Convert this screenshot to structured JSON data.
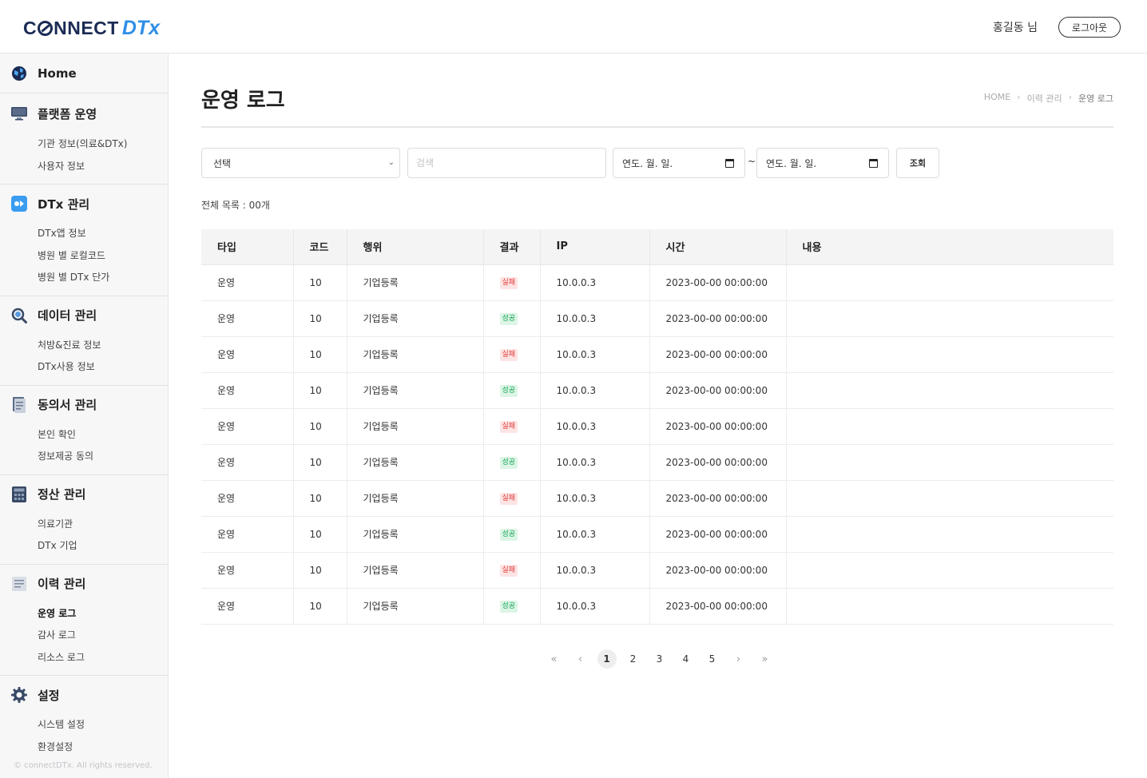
{
  "header": {
    "logo_prefix": "C",
    "logo_suffix": "NNECT",
    "logo_dtx": "DTx",
    "user_name": "홍길동 님",
    "logout_label": "로그아웃"
  },
  "sidebar": {
    "home_label": "Home",
    "sections": [
      {
        "label": "플랫폼 운영",
        "items": [
          "기관 정보(의료&DTx)",
          "사용자 정보"
        ]
      },
      {
        "label": "DTx 관리",
        "items": [
          "DTx앱 정보",
          "병원 별 로컬코드",
          "병원 별 DTx 단가"
        ]
      },
      {
        "label": "데이터 관리",
        "items": [
          "처방&진료 정보",
          "DTx사용 정보"
        ]
      },
      {
        "label": "동의서 관리",
        "items": [
          "본인 확인",
          "정보제공 동의"
        ]
      },
      {
        "label": "정산 관리",
        "items": [
          "의료기관",
          "DTx 기업"
        ]
      },
      {
        "label": "이력 관리",
        "items": [
          "운영 로그",
          "감사 로그",
          "리소스 로그"
        ]
      },
      {
        "label": "설정",
        "items": [
          "시스템 설정",
          "환경설정"
        ]
      }
    ],
    "copyright": "© connectDTx. All rights reserved."
  },
  "main": {
    "title": "운영 로그",
    "breadcrumb": [
      "HOME",
      "이력 관리",
      "운영 로그"
    ],
    "breadcrumb_sep": "›",
    "filters": {
      "select_value": "선택",
      "search_placeholder": "검색",
      "date_from": "연도. 월. 일.",
      "date_to": "연도. 월. 일.",
      "tilde": "~",
      "search_button": "조회"
    },
    "total_count": "전체 목록 : 00개",
    "table": {
      "columns": [
        "타입",
        "코드",
        "행위",
        "결과",
        "IP",
        "시간",
        "내용"
      ],
      "rows": [
        {
          "type": "운영",
          "code": "10",
          "action": "기업등록",
          "result": "실패",
          "status": "fail",
          "ip": "10.0.0.3",
          "time": "2023-00-00 00:00:00",
          "content": ""
        },
        {
          "type": "운영",
          "code": "10",
          "action": "기업등록",
          "result": "성공",
          "status": "ok",
          "ip": "10.0.0.3",
          "time": "2023-00-00 00:00:00",
          "content": ""
        },
        {
          "type": "운영",
          "code": "10",
          "action": "기업등록",
          "result": "실패",
          "status": "fail",
          "ip": "10.0.0.3",
          "time": "2023-00-00 00:00:00",
          "content": ""
        },
        {
          "type": "운영",
          "code": "10",
          "action": "기업등록",
          "result": "성공",
          "status": "ok",
          "ip": "10.0.0.3",
          "time": "2023-00-00 00:00:00",
          "content": ""
        },
        {
          "type": "운영",
          "code": "10",
          "action": "기업등록",
          "result": "실패",
          "status": "fail",
          "ip": "10.0.0.3",
          "time": "2023-00-00 00:00:00",
          "content": ""
        },
        {
          "type": "운영",
          "code": "10",
          "action": "기업등록",
          "result": "성공",
          "status": "ok",
          "ip": "10.0.0.3",
          "time": "2023-00-00 00:00:00",
          "content": ""
        },
        {
          "type": "운영",
          "code": "10",
          "action": "기업등록",
          "result": "실패",
          "status": "fail",
          "ip": "10.0.0.3",
          "time": "2023-00-00 00:00:00",
          "content": ""
        },
        {
          "type": "운영",
          "code": "10",
          "action": "기업등록",
          "result": "성공",
          "status": "ok",
          "ip": "10.0.0.3",
          "time": "2023-00-00 00:00:00",
          "content": ""
        },
        {
          "type": "운영",
          "code": "10",
          "action": "기업등록",
          "result": "실패",
          "status": "fail",
          "ip": "10.0.0.3",
          "time": "2023-00-00 00:00:00",
          "content": ""
        },
        {
          "type": "운영",
          "code": "10",
          "action": "기업등록",
          "result": "성공",
          "status": "ok",
          "ip": "10.0.0.3",
          "time": "2023-00-00 00:00:00",
          "content": ""
        }
      ]
    },
    "pagination": {
      "first": "«",
      "prev": "‹",
      "pages": [
        "1",
        "2",
        "3",
        "4",
        "5"
      ],
      "current": "1",
      "next": "›",
      "last": "»"
    }
  },
  "colors": {
    "brand_navy": "#1b2b55",
    "brand_blue": "#2f8fe8",
    "fail_text": "#e23b3b",
    "fail_bg": "#fde4e4",
    "success_text": "#18a558",
    "success_bg": "#dcf5e6"
  },
  "icons": {
    "home": "home-globe-icon",
    "platform": "monitor-icon",
    "dtx": "dtx-app-icon",
    "data": "magnifier-icon",
    "consent": "document-icon",
    "settlement": "calculator-icon",
    "history": "history-list-icon",
    "settings": "gear-icon",
    "calendar": "calendar-icon"
  }
}
